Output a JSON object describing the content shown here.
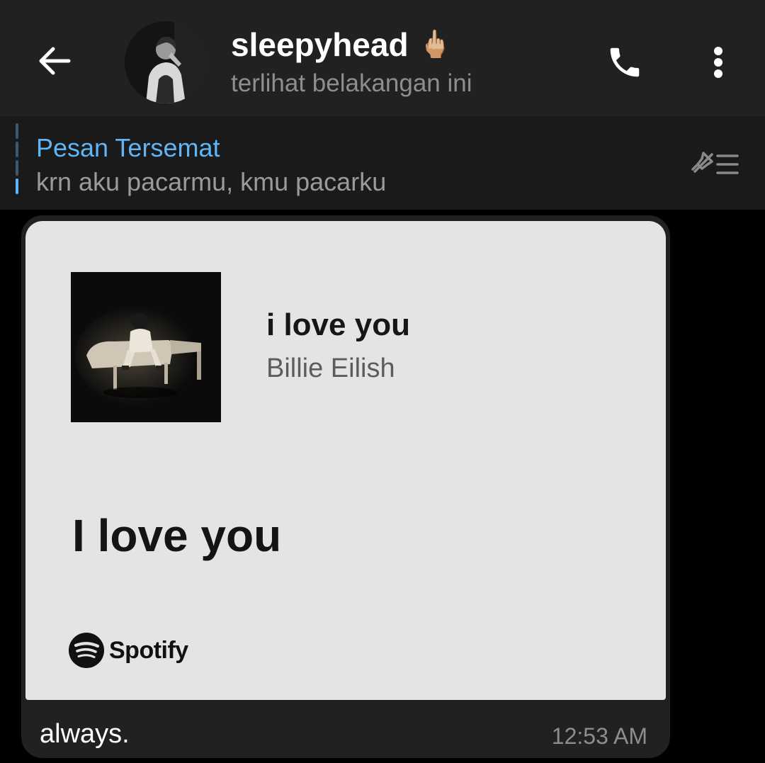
{
  "header": {
    "title": "sleepyhead",
    "title_emoji": "🖕🏼",
    "status": "terlihat belakangan ini",
    "icons": {
      "back": "arrow-left-icon",
      "call": "phone-icon",
      "menu": "more-vertical-icon"
    }
  },
  "pinned": {
    "label": "Pesan Tersemat",
    "text": "krn aku pacarmu, kmu pacarku",
    "icon": "pin-list-icon"
  },
  "message": {
    "card": {
      "song_title": "i love you",
      "artist": "Billie Eilish",
      "lyric": "I love you",
      "brand": "Spotify",
      "brand_icon": "spotify-logo-icon"
    },
    "caption": "always.",
    "time": "12:53 AM"
  },
  "colors": {
    "header_bg": "#212121",
    "pinned_bg": "#1a1a1a",
    "accent": "#5eb5f7",
    "bubble_bg": "#212121",
    "card_bg": "#e4e4e4"
  }
}
